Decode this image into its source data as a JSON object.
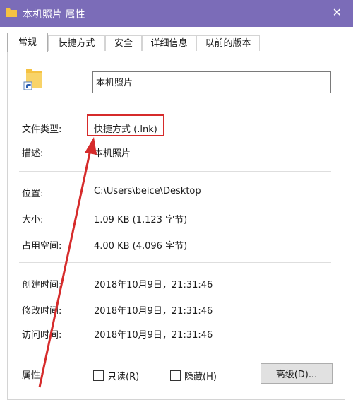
{
  "window": {
    "title": "本机照片 属性",
    "close_glyph": "✕"
  },
  "tabs": [
    {
      "label": "常规",
      "active": true
    },
    {
      "label": "快捷方式"
    },
    {
      "label": "安全"
    },
    {
      "label": "详细信息"
    },
    {
      "label": "以前的版本"
    }
  ],
  "general": {
    "name_value": "本机照片",
    "file_type": {
      "label": "文件类型:",
      "value": "快捷方式 (.lnk)"
    },
    "description": {
      "label": "描述:",
      "value": "本机照片"
    },
    "location": {
      "label": "位置:",
      "value": "C:\\Users\\beice\\Desktop"
    },
    "size": {
      "label": "大小:",
      "value": "1.09 KB (1,123 字节)"
    },
    "size_on_disk": {
      "label": "占用空间:",
      "value": "4.00 KB (4,096 字节)"
    },
    "created": {
      "label": "创建时间:",
      "value": "2018年10月9日，21:31:46"
    },
    "modified": {
      "label": "修改时间:",
      "value": "2018年10月9日，21:31:46"
    },
    "accessed": {
      "label": "访问时间:",
      "value": "2018年10月9日，21:31:46"
    },
    "attributes": {
      "label": "属性:",
      "readonly_label": "只读(R)",
      "hidden_label": "隐藏(H)",
      "advanced_label": "高级(D)..."
    }
  },
  "colors": {
    "titlebar": "#7b6cb8",
    "annotation": "#d62b2b",
    "folder": "#f5c242"
  }
}
